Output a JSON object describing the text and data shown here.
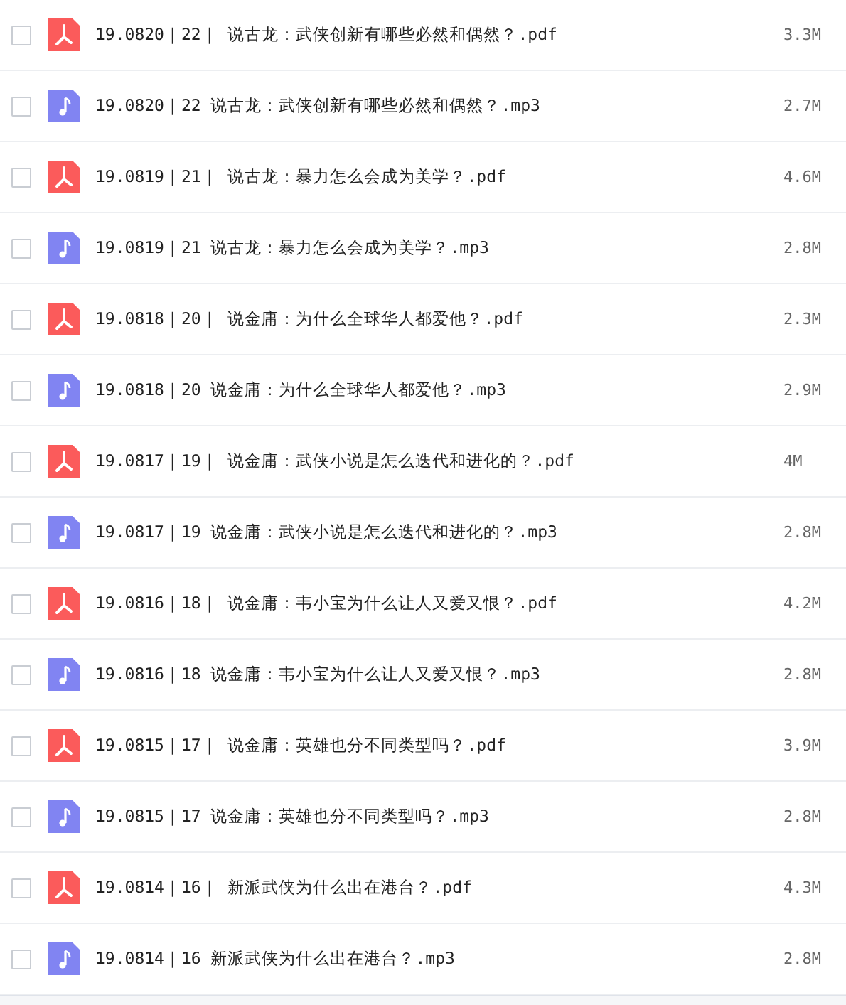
{
  "files": [
    {
      "kind": "pdf",
      "name": "19.0820｜22｜ 说古龙：武侠创新有哪些必然和偶然？.pdf",
      "size": "3.3M",
      "checked": false
    },
    {
      "kind": "mp3",
      "name": "19.0820｜22 说古龙：武侠创新有哪些必然和偶然？.mp3",
      "size": "2.7M",
      "checked": false
    },
    {
      "kind": "pdf",
      "name": "19.0819｜21｜ 说古龙：暴力怎么会成为美学？.pdf",
      "size": "4.6M",
      "checked": false
    },
    {
      "kind": "mp3",
      "name": "19.0819｜21 说古龙：暴力怎么会成为美学？.mp3",
      "size": "2.8M",
      "checked": false
    },
    {
      "kind": "pdf",
      "name": "19.0818｜20｜ 说金庸：为什么全球华人都爱他？.pdf",
      "size": "2.3M",
      "checked": false
    },
    {
      "kind": "mp3",
      "name": "19.0818｜20 说金庸：为什么全球华人都爱他？.mp3",
      "size": "2.9M",
      "checked": false
    },
    {
      "kind": "pdf",
      "name": "19.0817｜19｜ 说金庸：武侠小说是怎么迭代和进化的？.pdf",
      "size": "4M",
      "checked": false
    },
    {
      "kind": "mp3",
      "name": "19.0817｜19 说金庸：武侠小说是怎么迭代和进化的？.mp3",
      "size": "2.8M",
      "checked": false
    },
    {
      "kind": "pdf",
      "name": "19.0816｜18｜ 说金庸：韦小宝为什么让人又爱又恨？.pdf",
      "size": "4.2M",
      "checked": false
    },
    {
      "kind": "mp3",
      "name": "19.0816｜18 说金庸：韦小宝为什么让人又爱又恨？.mp3",
      "size": "2.8M",
      "checked": false
    },
    {
      "kind": "pdf",
      "name": "19.0815｜17｜ 说金庸：英雄也分不同类型吗？.pdf",
      "size": "3.9M",
      "checked": false
    },
    {
      "kind": "mp3",
      "name": "19.0815｜17 说金庸：英雄也分不同类型吗？.mp3",
      "size": "2.8M",
      "checked": false
    },
    {
      "kind": "pdf",
      "name": "19.0814｜16｜ 新派武侠为什么出在港台？.pdf",
      "size": "4.3M",
      "checked": false
    },
    {
      "kind": "mp3",
      "name": "19.0814｜16 新派武侠为什么出在港台？.mp3",
      "size": "2.8M",
      "checked": false
    }
  ]
}
